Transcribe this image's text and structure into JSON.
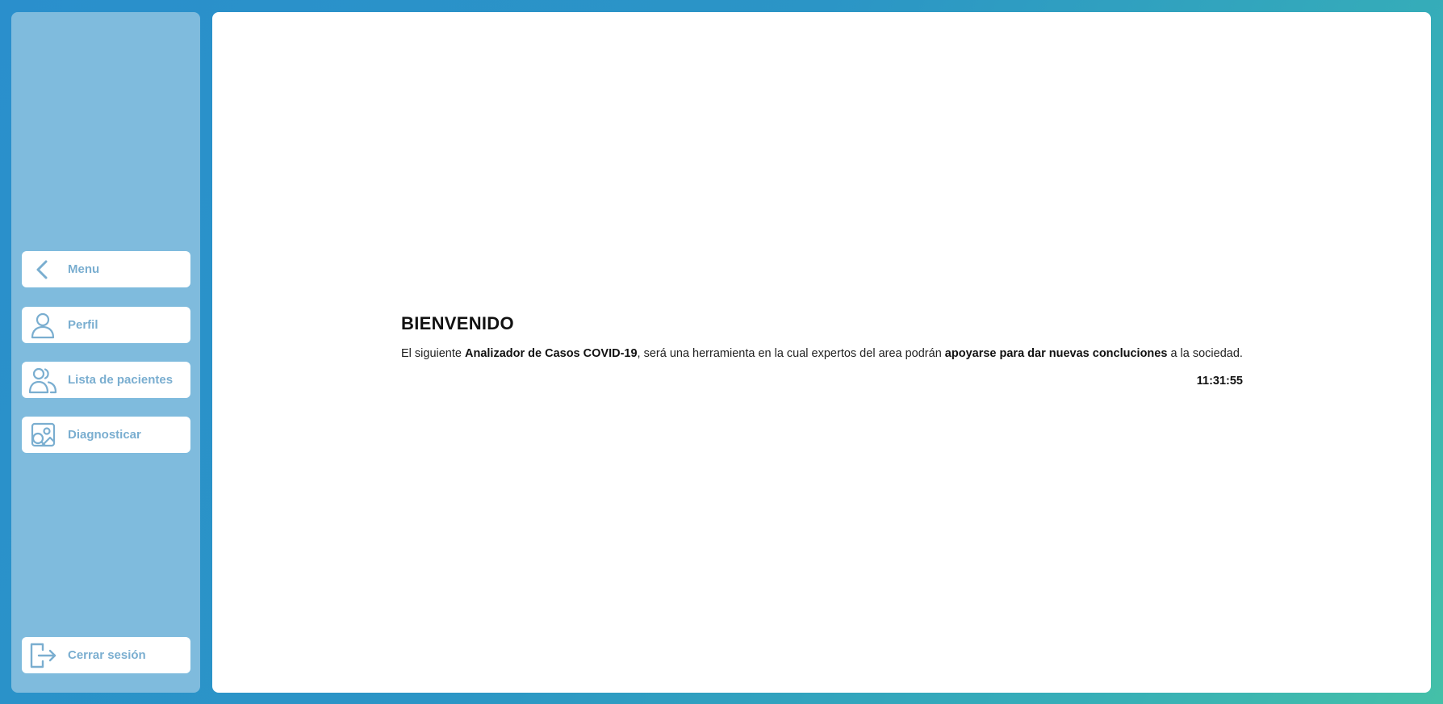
{
  "sidebar": {
    "items": [
      {
        "label": "Menu",
        "icon": "chevron-left-icon"
      },
      {
        "label": "Perfil",
        "icon": "user-icon"
      },
      {
        "label": "Lista de pacientes",
        "icon": "users-icon"
      },
      {
        "label": "Diagnosticar",
        "icon": "image-search-icon"
      }
    ],
    "logout": {
      "label": "Cerrar sesión",
      "icon": "logout-icon"
    }
  },
  "main": {
    "title": "BIENVENIDO",
    "text_1": "El siguiente ",
    "text_bold_1": "Analizador de Casos COVID-19",
    "text_2": ", será una herramienta en la cual expertos del area podrán ",
    "text_bold_2": "apoyarse para dar nuevas concluciones",
    "text_3": " a la sociedad.",
    "clock": "11:31:55"
  },
  "colors": {
    "accent": "#7aaed0",
    "sidebar_bg": "#7fbbdd",
    "bg_start": "#2a8fcc",
    "bg_end": "#44c0a8"
  }
}
